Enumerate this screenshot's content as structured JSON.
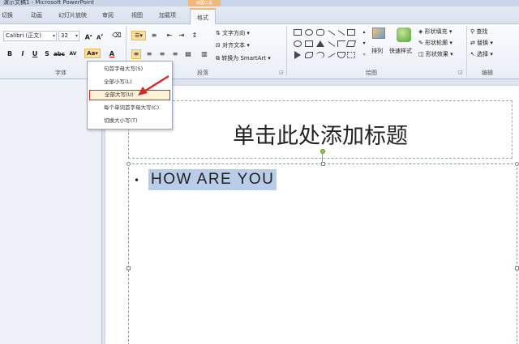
{
  "window": {
    "title": "演示文稿1 - Microsoft PowerPoint",
    "context_tab_group": "绘图工具"
  },
  "tabs": [
    "切换",
    "动画",
    "幻灯片放映",
    "审阅",
    "视图",
    "加载项",
    "格式"
  ],
  "ribbon": {
    "font": {
      "font_name": "Calibri (正文)",
      "font_size": "32",
      "label": "字体"
    },
    "paragraph": {
      "text_direction": "文字方向",
      "align_text": "对齐文本",
      "convert_smartart": "转换为 SmartArt",
      "label": "段落"
    },
    "drawing": {
      "arrange": "排列",
      "quick_styles": "快速样式",
      "shape_fill": "形状填充",
      "shape_outline": "形状轮廓",
      "shape_effects": "形状效果",
      "label": "绘图"
    },
    "editing": {
      "find": "查找",
      "replace": "替换",
      "select": "选择",
      "label": "编辑"
    }
  },
  "change_case_menu": {
    "items": [
      "句首字母大写(S)",
      "全部小写(L)",
      "全部大写(U)",
      "每个单词首字母大写(C)",
      "切换大小写(T)"
    ],
    "highlighted_index": 2
  },
  "slide": {
    "title": "单击此处添加标题",
    "body_text": "HOW ARE YOU"
  },
  "colors": {
    "highlight_border": "#d32a2a",
    "selection": "#b9cde8",
    "rotation_handle": "#8dc64a",
    "context_tab": "#f1b87a"
  }
}
